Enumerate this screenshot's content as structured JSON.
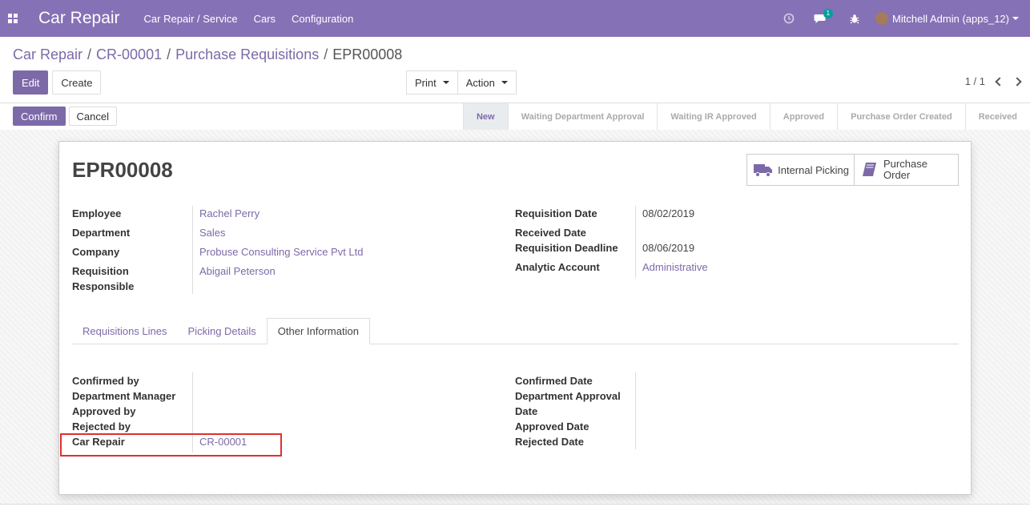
{
  "navbar": {
    "brand": "Car Repair",
    "menu": [
      "Car Repair / Service",
      "Cars",
      "Configuration"
    ],
    "messages_count": "1",
    "user_name": "Mitchell Admin (apps_12)"
  },
  "breadcrumb": [
    "Car Repair",
    "CR-00001",
    "Purchase Requisitions",
    "EPR00008"
  ],
  "control_panel": {
    "edit_label": "Edit",
    "create_label": "Create",
    "print_label": "Print",
    "action_label": "Action",
    "pager": "1 / 1"
  },
  "header": {
    "confirm_label": "Confirm",
    "cancel_label": "Cancel",
    "stages": [
      "New",
      "Waiting Department Approval",
      "Waiting IR Approved",
      "Approved",
      "Purchase Order Created",
      "Received"
    ],
    "current_stage": "New"
  },
  "record": {
    "title": "EPR00008",
    "smart_buttons": {
      "internal_picking": "Internal Picking",
      "purchase_order_line1": "Purchase",
      "purchase_order_line2": "Order"
    },
    "left_fields": {
      "employee_label": "Employee",
      "employee_value": "Rachel Perry",
      "department_label": "Department",
      "department_value": "Sales",
      "company_label": "Company",
      "company_value": "Probuse Consulting Service Pvt Ltd",
      "responsible_label_1": "Requisition",
      "responsible_label_2": "Responsible",
      "responsible_value": "Abigail Peterson"
    },
    "right_fields": {
      "req_date_label": "Requisition Date",
      "req_date_value": "08/02/2019",
      "received_date_label": "Received Date",
      "deadline_label": "Requisition Deadline",
      "deadline_value": "08/06/2019",
      "analytic_label": "Analytic Account",
      "analytic_value": "Administrative"
    },
    "tabs": [
      "Requisitions Lines",
      "Picking Details",
      "Other Information"
    ],
    "active_tab": "Other Information",
    "other_info_left": {
      "confirmed_by": "Confirmed by",
      "dept_manager": "Department Manager",
      "approved_by": "Approved by",
      "rejected_by": "Rejected by",
      "car_repair_label": "Car Repair",
      "car_repair_value": "CR-00001"
    },
    "other_info_right": {
      "confirmed_date": "Confirmed Date",
      "dept_approval_1": "Department Approval",
      "dept_approval_2": "Date",
      "approved_date": "Approved Date",
      "rejected_date": "Rejected Date"
    }
  }
}
